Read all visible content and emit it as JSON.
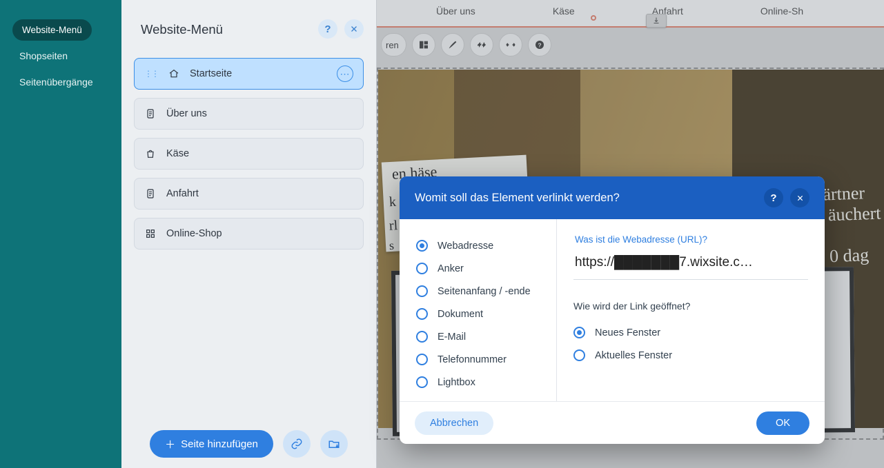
{
  "sidebar": {
    "active": "Website-Menü",
    "links": [
      "Shopseiten",
      "Seitenübergänge"
    ]
  },
  "menu_panel": {
    "title": "Website-Menü",
    "items": [
      {
        "label": "Startseite",
        "icon": "home",
        "selected": true
      },
      {
        "label": "Über uns",
        "icon": "doc"
      },
      {
        "label": "Käse",
        "icon": "bag"
      },
      {
        "label": "Anfahrt",
        "icon": "doc"
      },
      {
        "label": "Online-Shop",
        "icon": "grid"
      }
    ],
    "add_label": "Seite hinzufügen"
  },
  "topnav": {
    "items": [
      "Über uns",
      "Käse",
      "Anfahrt",
      "Online-Sh"
    ]
  },
  "scribbles": {
    "s1": "en häse",
    "s2": "k",
    "s3": "rl ö",
    "s4": "s",
    "right": "ärtner\n äuchert\n\n 0 dag"
  },
  "link_dialog": {
    "title": "Womit soll das Element verlinkt werden?",
    "options": [
      "Webadresse",
      "Anker",
      "Seitenanfang / -ende",
      "Dokument",
      "E-Mail",
      "Telefonnummer",
      "Lightbox"
    ],
    "selected_option": 0,
    "url_label": "Was ist die Webadresse (URL)?",
    "url_value": "https://███████7.wixsite.c…",
    "open_label": "Wie wird der Link geöffnet?",
    "open_options": [
      "Neues Fenster",
      "Aktuelles Fenster"
    ],
    "open_selected": 0,
    "cancel": "Abbrechen",
    "ok": "OK"
  }
}
